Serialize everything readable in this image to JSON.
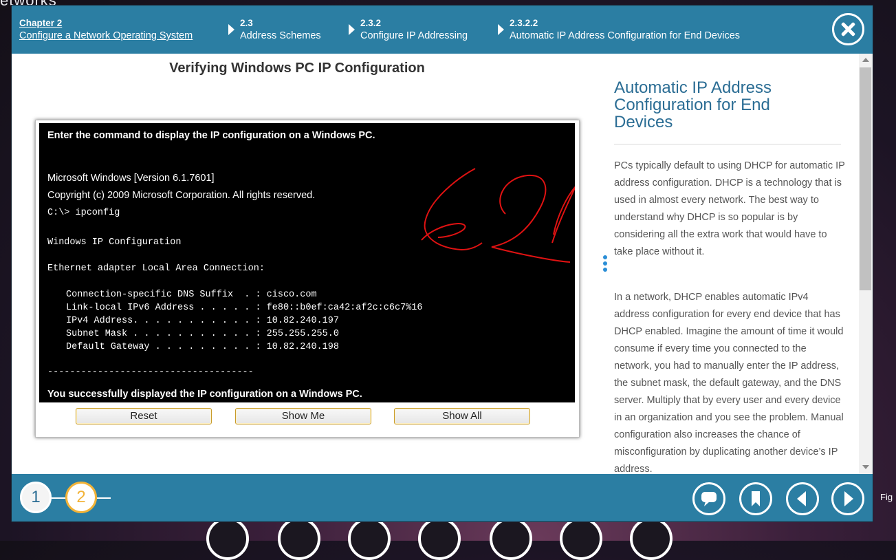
{
  "background": {
    "title_fragment": "etworks",
    "side_label": "Fig"
  },
  "breadcrumb": {
    "chapter_num": "Chapter 2",
    "chapter_title": "Configure a Network Operating System",
    "section_num": "2.3",
    "section_title": "Address Schemes",
    "subsection_num": "2.3.2",
    "subsection_title": "Configure IP Addressing",
    "topic_num": "2.3.2.2",
    "topic_title": "Automatic IP Address Configuration for End Devices"
  },
  "figure": {
    "title": "Verifying Windows PC IP Configuration",
    "instruction": "Enter the command to display the IP configuration on a Windows PC.",
    "os_version": "Microsoft Windows [Version 6.1.7601]",
    "copyright": "Copyright (c) 2009 Microsoft Corporation. All rights reserved.",
    "prompt": "C:\\> ipconfig",
    "ip_header": "Windows IP Configuration",
    "adapter": "Ethernet adapter Local Area Connection:",
    "lines": [
      "Connection-specific DNS Suffix  . : cisco.com",
      "Link-local IPv6 Address . . . . . : fe80::b0ef:ca42:af2c:c6c7%16",
      "IPv4 Address. . . . . . . . . . . : 10.82.240.197",
      "Subnet Mask . . . . . . . . . . . : 255.255.255.0",
      "Default Gateway . . . . . . . . . : 10.82.240.198"
    ],
    "separator": "-------------------------------------",
    "success": "You successfully displayed the IP configuration on a Windows PC.",
    "buttons": {
      "reset": "Reset",
      "show_me": "Show Me",
      "show_all": "Show All"
    }
  },
  "side": {
    "title": "Automatic IP Address Configuration for End Devices",
    "p1": "PCs typically default to using DHCP for automatic IP address configuration. DHCP is a technology that is used in almost every network. The best way to understand why DHCP is so popular is by considering all the extra work that would have to take place without it.",
    "p2": "In a network, DHCP enables automatic IPv4 address configuration for every end device that has DHCP enabled. Imagine the amount of time it would consume if every time you connected to the network, you had to manually enter the IP address, the subnet mask, the default gateway, and the DNS server. Multiply that by every user and every device in an organization and you see the problem. Manual configuration also increases the chance of misconfiguration by duplicating another device’s IP address."
  },
  "footer": {
    "figures": [
      "1",
      "2"
    ],
    "selected_figure": "2"
  },
  "colors": {
    "bar_blue": "#2b7ea3",
    "accent_gold": "#f2b338",
    "title_blue": "#2b6d94"
  }
}
